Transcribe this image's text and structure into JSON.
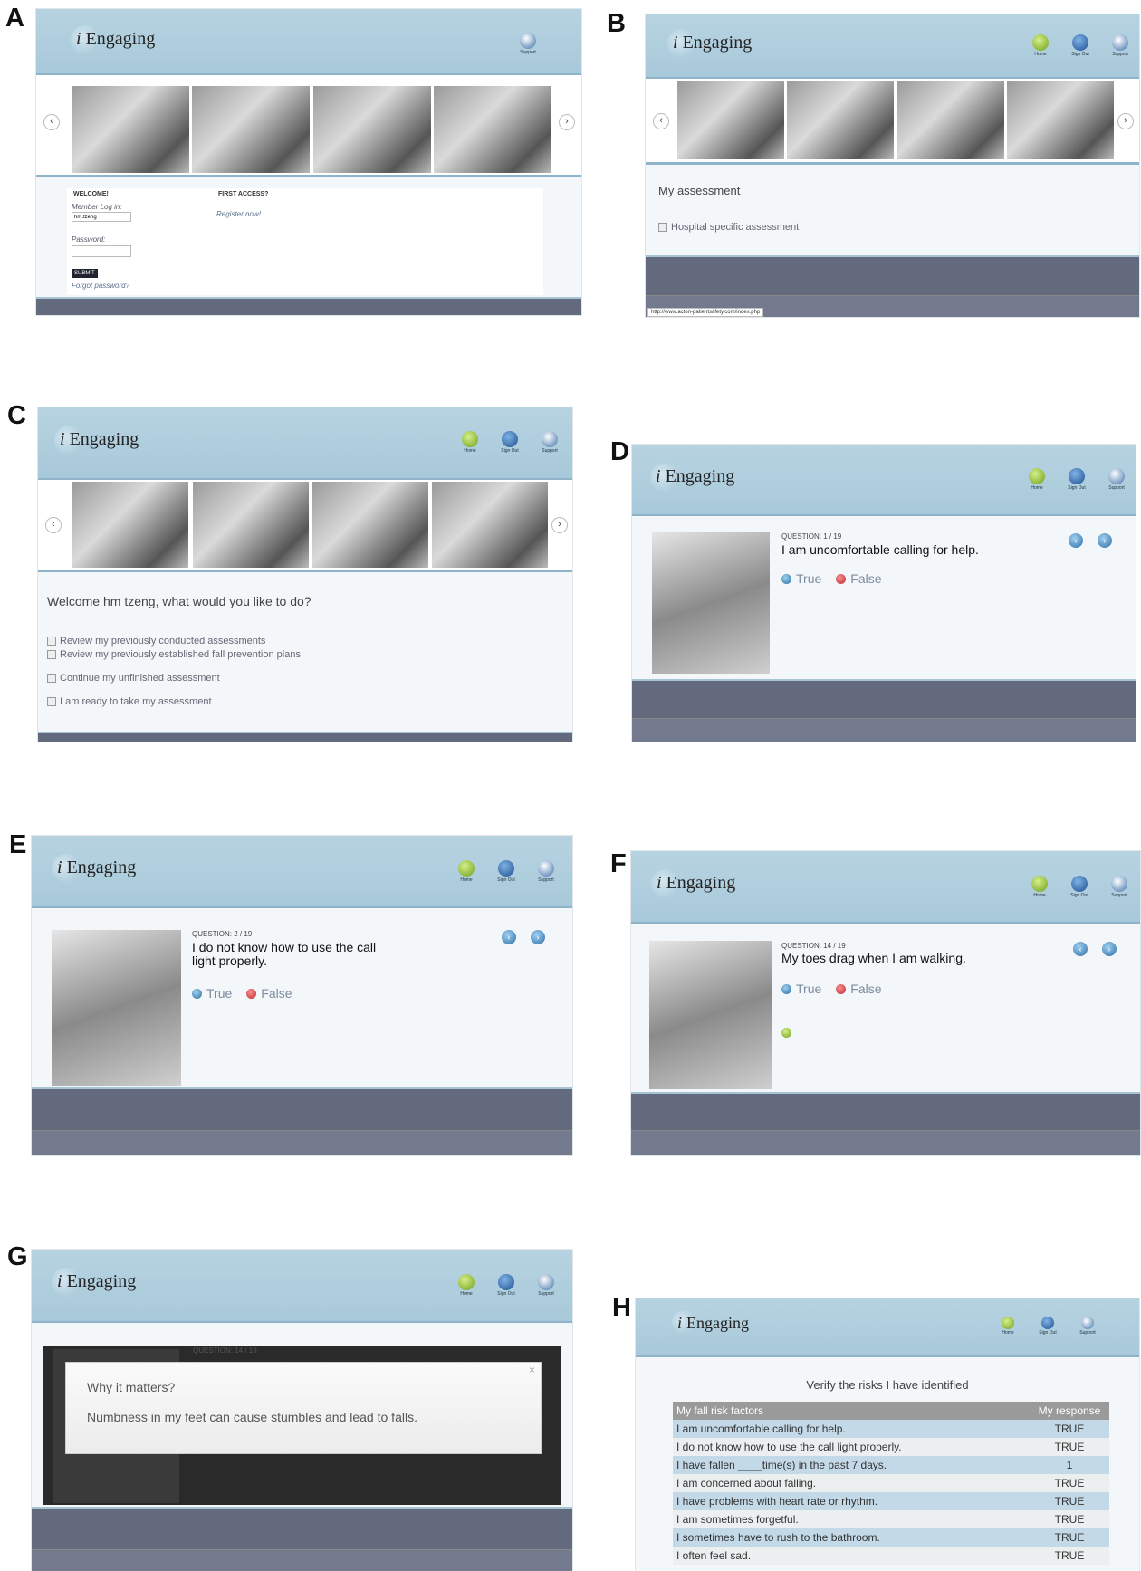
{
  "panels": {
    "a": {
      "letter": "A"
    },
    "b": {
      "letter": "B"
    },
    "c": {
      "letter": "C"
    },
    "d": {
      "letter": "D"
    },
    "e": {
      "letter": "E"
    },
    "f": {
      "letter": "F"
    },
    "g": {
      "letter": "G"
    },
    "h": {
      "letter": "H"
    }
  },
  "brand": {
    "i": "i",
    "name": "Engaging"
  },
  "nav": {
    "home": "Home",
    "signout": "Sign Out",
    "support": "Support"
  },
  "login": {
    "welcome": "WELCOME!",
    "member_login": "Member Log in:",
    "username_value": "hm.tzeng",
    "password_label": "Password:",
    "submit": "SUBMIT",
    "forgot": "Forgot password?",
    "first_access": "FIRST ACCESS?",
    "register": "Register now!"
  },
  "panel_b": {
    "title": "My assessment",
    "link": "Hospital specific assessment",
    "status_url": "http://www.acton-patientsafety.com/index.php"
  },
  "panel_c": {
    "welcome": "Welcome hm tzeng, what would you like to do?",
    "links": [
      "Review my previously conducted assessments",
      "Review my previously established fall prevention plans",
      "Continue my unfinished assessment",
      "I am ready to take my assessment"
    ]
  },
  "panel_d": {
    "qnum": "QUESTION: 1 / 19",
    "question": "I am uncomfortable calling for help."
  },
  "panel_e": {
    "qnum": "QUESTION: 2 / 19",
    "question_l1": "I do not know how to use the call",
    "question_l2": "light properly."
  },
  "panel_f": {
    "qnum": "QUESTION: 14 / 19",
    "question": "My toes drag when I am walking."
  },
  "answers": {
    "true": "True",
    "false": "False"
  },
  "panel_g": {
    "bg_qnum": "QUESTION: 14 / 19",
    "modal_title": "Why it matters?",
    "modal_body": "Numbness in my feet can cause stumbles and lead to falls.",
    "close": "×"
  },
  "panel_h": {
    "heading": "Verify the risks I have identified",
    "col_factor": "My fall risk factors",
    "col_response": "My response",
    "rows": [
      {
        "factor": "I am uncomfortable calling for help.",
        "response": "TRUE"
      },
      {
        "factor": "I do not know how to use the call light properly.",
        "response": "TRUE"
      },
      {
        "factor": "I have fallen ____time(s) in the past 7 days.",
        "response": "1"
      },
      {
        "factor": "I am concerned about falling.",
        "response": "TRUE"
      },
      {
        "factor": "I have problems with heart rate or rhythm.",
        "response": "TRUE"
      },
      {
        "factor": "I am sometimes forgetful.",
        "response": "TRUE"
      },
      {
        "factor": "I sometimes have to rush to the bathroom.",
        "response": "TRUE"
      },
      {
        "factor": "I often feel sad.",
        "response": "TRUE"
      }
    ]
  }
}
